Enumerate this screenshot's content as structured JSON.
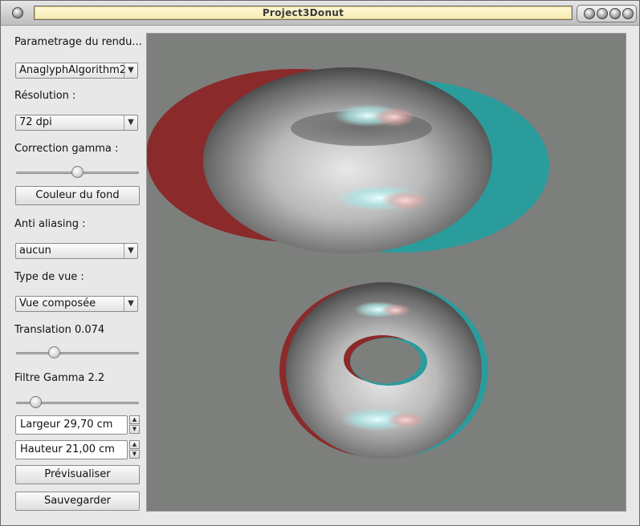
{
  "window": {
    "title": "Project3Donut"
  },
  "titlebar_buttons": {
    "menu": "●",
    "minimize": "●",
    "shade": "●",
    "maximize": "●",
    "close": "●"
  },
  "sidebar": {
    "section_title": "Parametrage du rendu...",
    "algorithm": {
      "value": "AnaglyphAlgorithm2"
    },
    "resolution": {
      "label": "Résolution :",
      "value": "72 dpi"
    },
    "gamma_correction": {
      "label": "Correction gamma :",
      "slider_level": 0.5
    },
    "background_color_button": "Couleur du fond",
    "antialiasing": {
      "label": "Anti aliasing :",
      "value": "aucun"
    },
    "view_type": {
      "label": "Type de vue :",
      "value": "Vue composée"
    },
    "translation": {
      "label": "Translation 0.074",
      "slider_level": 0.3
    },
    "gamma_filter": {
      "label": "Filtre Gamma 2.2",
      "slider_level": 0.15
    },
    "width": {
      "value": "Largeur 29,70 cm"
    },
    "height": {
      "value": "Hauteur 21,00 cm"
    },
    "preview_button": "Prévisualiser",
    "save_button": "Sauvegarder"
  },
  "colors": {
    "viewport_bg": "#7d7f7c",
    "anaglyph_red": "#8a2a2a",
    "anaglyph_cyan": "#2a9c9c"
  }
}
